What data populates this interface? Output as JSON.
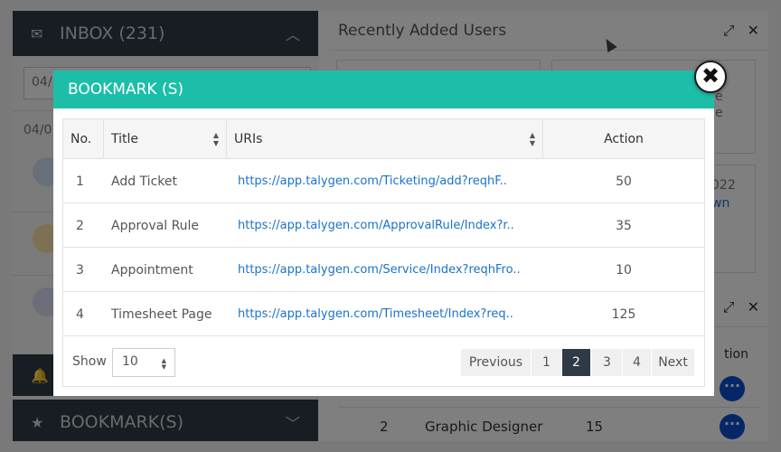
{
  "background": {
    "inbox_label": "INBOX (231)",
    "left_field_fragment": "04/",
    "left_date_fragment": "04/0",
    "bookmarks_label": "BOOKMARK(S)",
    "recent_users_title": "Recently Added Users",
    "card_fragment_1": "e",
    "card_fragment_2": "e",
    "card_fragment_3": "022",
    "card_fragment_4": "wn",
    "action_header_fragment": "tion",
    "bg_rows": [
      {
        "no": "2",
        "title": "Graphic Designer",
        "count": "15"
      }
    ]
  },
  "modal": {
    "title": "BOOKMARK (S)",
    "close_symbol": "✖",
    "columns": {
      "no": "No.",
      "title": "Title",
      "uris": "URIs",
      "action": "Action"
    },
    "rows": [
      {
        "no": "1",
        "title": "Add Ticket",
        "uri": "https://app.talygen.com/Ticketing/add?reqhF..",
        "action": "50"
      },
      {
        "no": "2",
        "title": "Approval Rule",
        "uri": "https://app.talygen.com/ApprovalRule/Index?r..",
        "action": "35"
      },
      {
        "no": "3",
        "title": "Appointment",
        "uri": "https://app.talygen.com/Service/Index?reqhFro..",
        "action": "10"
      },
      {
        "no": "4",
        "title": "Timesheet Page",
        "uri": "https://app.talygen.com/Timesheet/Index?req..",
        "action": "125"
      }
    ],
    "show_label": "Show",
    "page_size": "10",
    "pagination": {
      "previous": "Previous",
      "pages": [
        "1",
        "2",
        "3",
        "4"
      ],
      "current": "2",
      "next": "Next"
    }
  },
  "colors": {
    "header_teal": "#1cbea8",
    "link_blue": "#1a73c9",
    "active_page": "#2e3a46",
    "dark_sidebar": "#2e3a46"
  }
}
